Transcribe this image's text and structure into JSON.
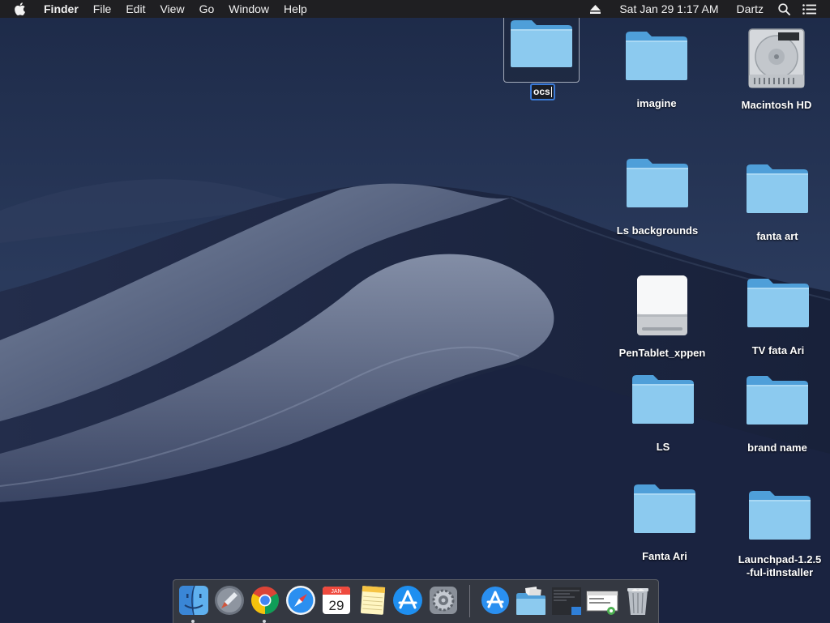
{
  "menubar": {
    "app_name": "Finder",
    "menus": [
      "File",
      "Edit",
      "View",
      "Go",
      "Window",
      "Help"
    ],
    "clock": "Sat Jan 29  1:17 AM",
    "user": "Dartz"
  },
  "desktop": {
    "rename_value": "ocs",
    "icons": [
      {
        "label": "imagine",
        "kind": "folder"
      },
      {
        "label": "Macintosh HD",
        "kind": "hard-drive"
      },
      {
        "label": "Ls backgrounds",
        "kind": "folder"
      },
      {
        "label": "fanta art",
        "kind": "folder"
      },
      {
        "label": "PenTablet_xppen",
        "kind": "external-drive"
      },
      {
        "label": "TV fata Ari",
        "kind": "folder"
      },
      {
        "label": "LS",
        "kind": "folder"
      },
      {
        "label": "brand name",
        "kind": "folder"
      },
      {
        "label": "Fanta Ari",
        "kind": "folder"
      },
      {
        "label": "Launchpad-1.2.5\n-ful-itInstaller",
        "kind": "folder"
      }
    ]
  },
  "dock": {
    "calendar_month": "JAN",
    "calendar_day": "29",
    "apps": [
      "finder-icon",
      "launchpad-icon",
      "chrome-icon",
      "safari-icon",
      "calendar-icon",
      "notes-icon",
      "app-store-icon",
      "system-preferences-icon"
    ],
    "stacks": [
      "app-store-download-icon",
      "folder-stack-icon",
      "screenshot-stack-icon",
      "window-thumbnail-icon",
      "trash-icon"
    ]
  },
  "colors": {
    "menubar_bg": "#1f1f22",
    "folder_light": "#8fc9ee",
    "folder_dark": "#4a9bd6",
    "selection_border": "#3a79d6"
  }
}
